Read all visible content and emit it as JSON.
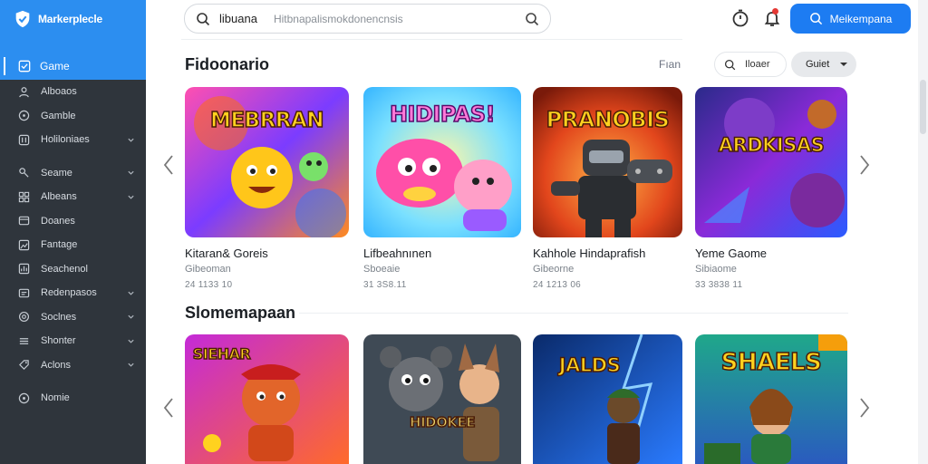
{
  "app": {
    "brand": "Markerplecle"
  },
  "sidebar": {
    "active": {
      "label": "Game"
    },
    "items": [
      {
        "label": "Alboaos",
        "icon": "user-icon",
        "chevron": false
      },
      {
        "label": "Gamble",
        "icon": "gamepad-icon",
        "chevron": false
      },
      {
        "label": "Holiloniaes",
        "icon": "sliders-icon",
        "chevron": true
      },
      {
        "label": "Seame",
        "icon": "person-icon",
        "chevron": true
      },
      {
        "label": "Albeans",
        "icon": "grid-icon",
        "chevron": true
      },
      {
        "label": "Doanes",
        "icon": "folder-icon",
        "chevron": false
      },
      {
        "label": "Fantage",
        "icon": "image-icon",
        "chevron": false
      },
      {
        "label": "Seachenol",
        "icon": "chart-icon",
        "chevron": false
      },
      {
        "label": "Redenpasos",
        "icon": "list-icon",
        "chevron": true
      },
      {
        "label": "Soclnes",
        "icon": "gear-icon",
        "chevron": true
      },
      {
        "label": "Shonter",
        "icon": "menu-icon",
        "chevron": true
      },
      {
        "label": "Aclons",
        "icon": "tag-icon",
        "chevron": true
      }
    ],
    "footer": {
      "label": "Nomie",
      "icon": "help-icon"
    }
  },
  "search": {
    "query": "libuana",
    "placeholder": "Hitbnapalismokdonencnsis"
  },
  "header": {
    "cta_label": "Meikempana"
  },
  "section1": {
    "title": "Fidoonario",
    "see_all": "Fıan",
    "filter_label": "Iloaer",
    "sort_label": "Guiet",
    "cards": [
      {
        "title": "Kitaran& Goreis",
        "sub": "Gibeoman",
        "meta": "24 1133 10",
        "art": "MEBRRAN"
      },
      {
        "title": "Lifbeahnınen",
        "sub": "Sboeaie",
        "meta": "31 3S8.11",
        "art": "HIDIPAS!"
      },
      {
        "title": "Kahhole Hindaprafish",
        "sub": "Gibeorne",
        "meta": "24 1213 06",
        "art": "PRANOBIS"
      },
      {
        "title": "Yeme Gaome",
        "sub": "Sibiaome",
        "meta": "33 3838 11",
        "art": "ARDKISAS"
      }
    ]
  },
  "section2": {
    "title": "Slomemapaan",
    "cards": [
      {
        "art": "SIEHAR"
      },
      {
        "art": "HIDOKEE"
      },
      {
        "art": "JALDS"
      },
      {
        "art": "SHAELS"
      }
    ]
  }
}
